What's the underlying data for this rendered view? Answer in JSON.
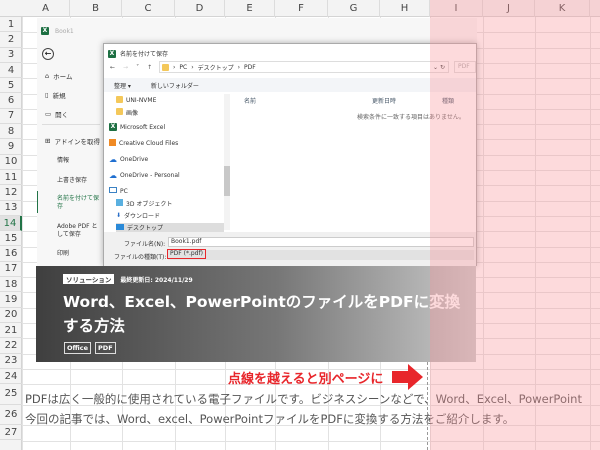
{
  "sheet": {
    "columns": [
      "A",
      "B",
      "C",
      "D",
      "E",
      "F",
      "G",
      "H",
      "I",
      "J",
      "K"
    ],
    "rows": [
      "1",
      "2",
      "3",
      "4",
      "5",
      "6",
      "7",
      "8",
      "9",
      "10",
      "11",
      "12",
      "13",
      "14",
      "15",
      "16",
      "17",
      "18",
      "19",
      "20",
      "21",
      "22",
      "23",
      "24",
      "25",
      "26",
      "27"
    ],
    "selected_row": "14"
  },
  "backstage": {
    "title": "Book1",
    "items": [
      {
        "icon": "home-icon",
        "label": "ホーム"
      },
      {
        "icon": "new-file-icon",
        "label": "新規"
      },
      {
        "icon": "open-folder-icon",
        "label": "開く"
      },
      {
        "icon": "addins-icon",
        "label": "アドインを取得"
      }
    ],
    "subitems": [
      "情報",
      "上書き保存",
      "名前を付けて保存",
      "Adobe PDF として保存",
      "印刷"
    ],
    "active": "名前を付けて保存"
  },
  "dialog": {
    "title": "名前を付けて保存",
    "breadcrumb": [
      "PC",
      "デスクトップ",
      "PDF"
    ],
    "search": "PDF",
    "toolbar": {
      "organize": "整理 ▾",
      "new_folder": "新しいフォルダー"
    },
    "tree": [
      {
        "icon": "folder-icon",
        "label": "UNI-NVME"
      },
      {
        "icon": "folder-icon",
        "label": "画像"
      },
      {
        "icon": "excel-icon",
        "label": "Microsoft Excel"
      },
      {
        "icon": "creative-cloud-icon",
        "label": "Creative Cloud Files"
      },
      {
        "icon": "onedrive-icon",
        "label": "OneDrive"
      },
      {
        "icon": "onedrive-icon",
        "label": "OneDrive - Personal"
      },
      {
        "icon": "pc-icon",
        "label": "PC"
      },
      {
        "icon": "3d-objects-icon",
        "label": "3D オブジェクト"
      },
      {
        "icon": "download-icon",
        "label": "ダウンロード"
      },
      {
        "icon": "desktop-icon",
        "label": "デスクトップ"
      }
    ],
    "columns": [
      "名前",
      "更新日時",
      "種類"
    ],
    "empty": "検索条件に一致する項目はありません。",
    "filename_label": "ファイル名(N):",
    "filename": "Book1.pdf",
    "filetype_label": "ファイルの種類(T):",
    "filetype": "PDF (*.pdf)"
  },
  "banner": {
    "category": "ソリューション",
    "updated": "最終更新日: 2024/11/29",
    "title_line1": "Word、Excel、PowerPointのファイルをPDFに変換",
    "title_line2": "する方法",
    "tags": [
      "Office",
      "PDF"
    ]
  },
  "annotation": {
    "text": "点線を越えると別ページに",
    "color": "#e8262b"
  },
  "cells": {
    "row25": "PDFは広く一般的に使用されている電子ファイルです。ビジネスシーンなどで、Word、Excel、PowerPoint",
    "row26": "今回の記事では、Word、excel、PowerPointファイルをPDFに変換する方法をご紹介します。"
  }
}
